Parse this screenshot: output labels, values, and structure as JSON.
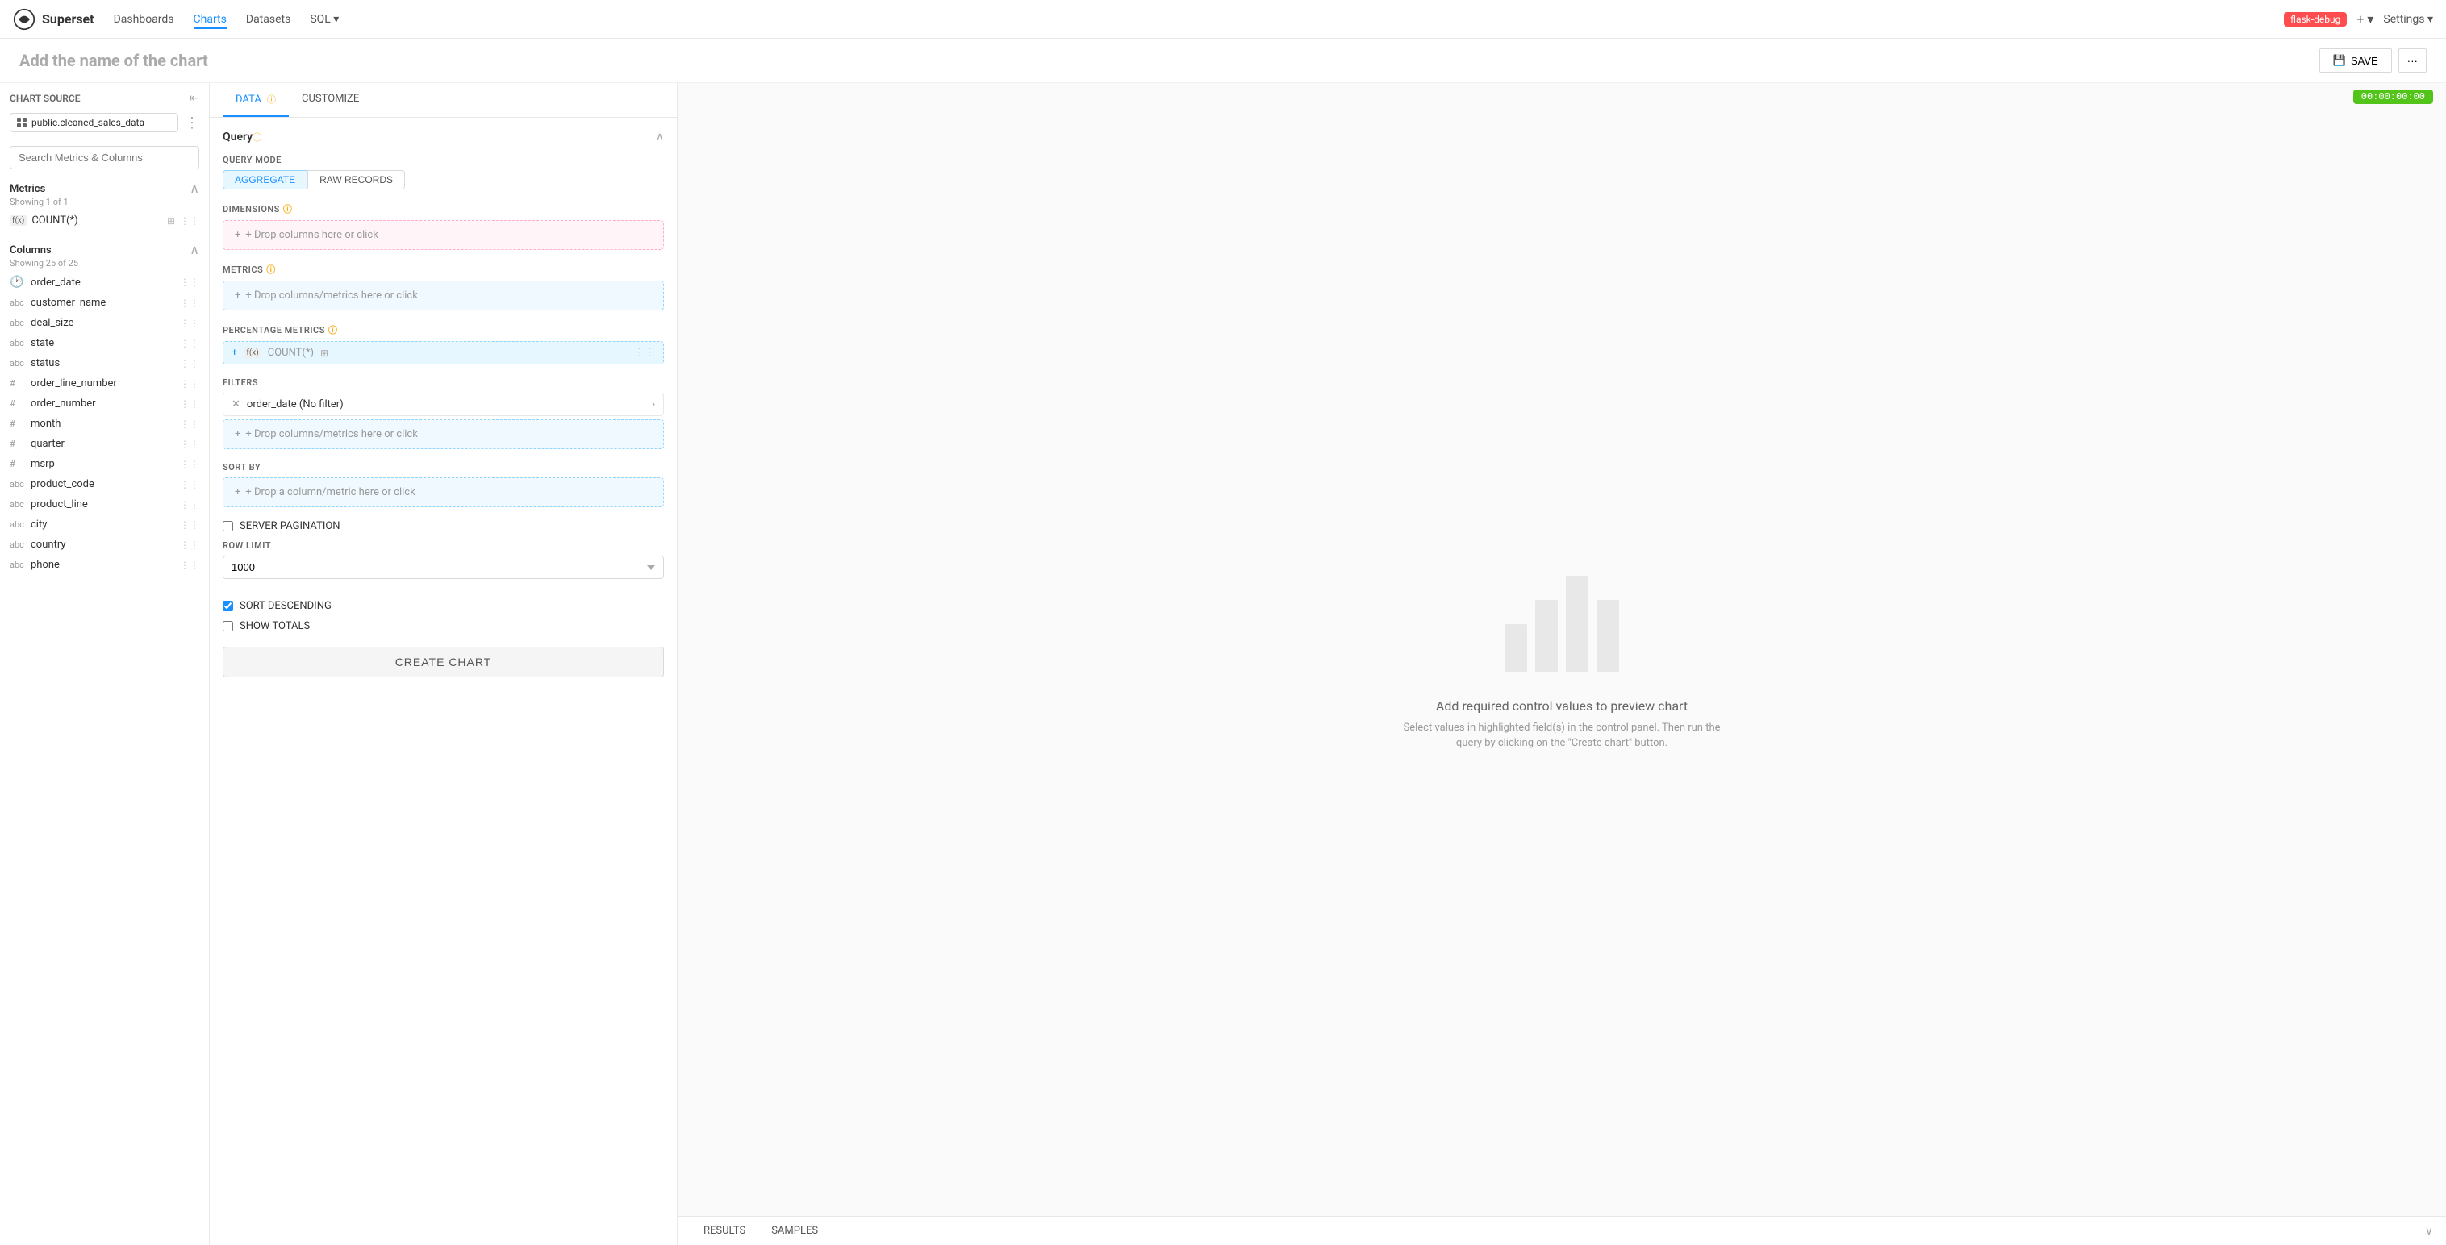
{
  "nav": {
    "logo_text": "Superset",
    "links": [
      {
        "label": "Dashboards",
        "active": false
      },
      {
        "label": "Charts",
        "active": true
      },
      {
        "label": "Datasets",
        "active": false
      },
      {
        "label": "SQL ▾",
        "active": false
      }
    ],
    "debug_badge": "flask-debug",
    "plus": "+ ▾",
    "settings": "Settings ▾"
  },
  "page": {
    "chart_name_placeholder": "Add the name of the chart",
    "save_label": "SAVE",
    "more_label": "···"
  },
  "timer": "00:00:00:00",
  "left_panel": {
    "chart_source_label": "Chart Source",
    "source_name": "public.cleaned_sales_data",
    "search_placeholder": "Search Metrics & Columns",
    "metrics_label": "Metrics",
    "metrics_count": "Showing 1 of 1",
    "metrics": [
      {
        "type": "f(x)",
        "name": "COUNT(*)"
      }
    ],
    "columns_label": "Columns",
    "columns_count": "Showing 25 of 25",
    "columns": [
      {
        "type": "🕐",
        "name": "order_date",
        "kind": "date"
      },
      {
        "type": "abc",
        "name": "customer_name"
      },
      {
        "type": "abc",
        "name": "deal_size"
      },
      {
        "type": "abc",
        "name": "state"
      },
      {
        "type": "abc",
        "name": "status"
      },
      {
        "type": "#",
        "name": "order_line_number"
      },
      {
        "type": "#",
        "name": "order_number"
      },
      {
        "type": "#",
        "name": "month"
      },
      {
        "type": "#",
        "name": "quarter"
      },
      {
        "type": "#",
        "name": "msrp"
      },
      {
        "type": "abc",
        "name": "product_code"
      },
      {
        "type": "abc",
        "name": "product_line"
      },
      {
        "type": "abc",
        "name": "city"
      },
      {
        "type": "abc",
        "name": "country"
      },
      {
        "type": "abc",
        "name": "phone"
      }
    ]
  },
  "middle_panel": {
    "tabs": [
      {
        "label": "DATA",
        "active": true,
        "info": true
      },
      {
        "label": "CUSTOMIZE",
        "active": false,
        "info": false
      }
    ],
    "query_label": "Query",
    "query_mode_label": "QUERY MODE",
    "query_modes": [
      {
        "label": "AGGREGATE",
        "active": true
      },
      {
        "label": "RAW RECORDS",
        "active": false
      }
    ],
    "dimensions_label": "DIMENSIONS",
    "dimensions_placeholder": "+ Drop columns here or click",
    "metrics_label": "METRICS",
    "metrics_placeholder": "+ Drop columns/metrics here or click",
    "pct_metrics_label": "PERCENTAGE METRICS",
    "pct_metric_value": "COUNT(*)",
    "filters_label": "FILTERS",
    "filter_item": "order_date (No filter)",
    "filters_placeholder": "+ Drop columns/metrics here or click",
    "sort_by_label": "SORT BY",
    "sort_by_placeholder": "+ Drop a column/metric here or click",
    "server_pagination_label": "SERVER PAGINATION",
    "row_limit_label": "ROW LIMIT",
    "row_limit_value": "1000",
    "sort_desc_label": "SORT DESCENDING",
    "show_totals_label": "SHOW TOTALS",
    "create_chart_label": "CREATE CHART"
  },
  "right_panel": {
    "preview_title": "Add required control values to preview chart",
    "preview_desc": "Select values in highlighted field(s) in the control panel. Then run the query by clicking on the \"Create chart\" button.",
    "bar_heights": [
      60,
      90,
      120,
      90
    ],
    "bar_widths": [
      28,
      28,
      28,
      28
    ]
  },
  "bottom_tabs": [
    {
      "label": "RESULTS"
    },
    {
      "label": "SAMPLES"
    }
  ]
}
